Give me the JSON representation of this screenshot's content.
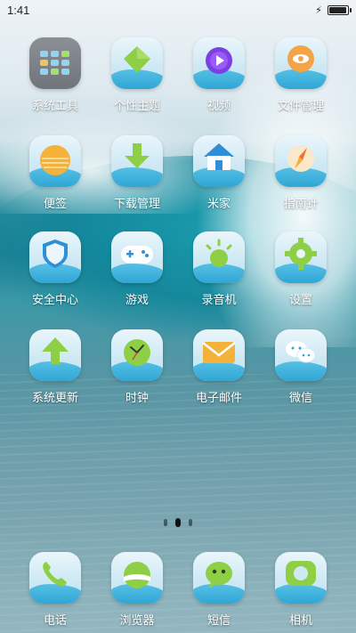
{
  "status_bar": {
    "time": "1:41",
    "battery_level": 0.95
  },
  "apps": [
    {
      "label": "系统工具",
      "icon": "folder-grid-icon"
    },
    {
      "label": "个性主题",
      "icon": "diamond-theme-icon"
    },
    {
      "label": "视频",
      "icon": "play-video-icon"
    },
    {
      "label": "文件管理",
      "icon": "folder-eye-icon"
    },
    {
      "label": "便签",
      "icon": "notepad-sun-icon"
    },
    {
      "label": "下载管理",
      "icon": "download-arrow-icon"
    },
    {
      "label": "米家",
      "icon": "home-house-icon"
    },
    {
      "label": "指南针",
      "icon": "compass-icon"
    },
    {
      "label": "安全中心",
      "icon": "shield-icon"
    },
    {
      "label": "游戏",
      "icon": "gamepad-icon"
    },
    {
      "label": "录音机",
      "icon": "recorder-icon"
    },
    {
      "label": "设置",
      "icon": "gear-icon"
    },
    {
      "label": "系统更新",
      "icon": "update-arrow-icon"
    },
    {
      "label": "时钟",
      "icon": "clock-icon"
    },
    {
      "label": "电子邮件",
      "icon": "email-envelope-icon"
    },
    {
      "label": "微信",
      "icon": "wechat-icon"
    }
  ],
  "page_indicator": {
    "count": 3,
    "active_index": 1
  },
  "dock": [
    {
      "label": "电话",
      "icon": "phone-icon"
    },
    {
      "label": "浏览器",
      "icon": "browser-icon"
    },
    {
      "label": "短信",
      "icon": "messages-icon"
    },
    {
      "label": "相机",
      "icon": "camera-icon"
    }
  ],
  "colors": {
    "tile_top": "#eaf6fb",
    "tile_wave": "#2fa6d6",
    "icon_green": "#8ecf45",
    "icon_orange": "#f4b23a"
  }
}
